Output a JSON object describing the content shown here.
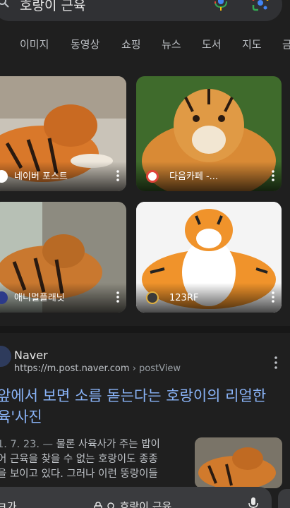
{
  "search": {
    "query": "호랑이 근육"
  },
  "tabs": [
    "이미지",
    "동영상",
    "쇼핑",
    "뉴스",
    "도서",
    "지도",
    "금"
  ],
  "images": [
    {
      "source": "네이버 포스트"
    },
    {
      "source": "다음카페 -..."
    },
    {
      "source": "애니멀플래닛"
    },
    {
      "source": "123RF"
    }
  ],
  "result": {
    "site_name": "Naver",
    "url": "https://m.post.naver.com",
    "breadcrumb": " › postView",
    "title_line1": "앞에서 보면 소름 돋는다는 호랑이의 리얼한",
    "title_line2": "육'사진",
    "snippet_date": "1. 7. 23. — ",
    "snippet_line1": "물론 사육사가 주는 밥이",
    "snippet_line2": "어 근육을 찾을 수 없는 호랑이도 종종",
    "snippet_line3": "을 보이고 있다. 그러나 이런 뚱랑이들"
  },
  "bottom_bar": {
    "left_text": "ㅋ가",
    "query": "호랑이 근육"
  },
  "colors": {
    "background": "#1f1f1f",
    "link": "#8ab4f8",
    "google_blue": "#4285f4",
    "google_red": "#ea4335",
    "google_yellow": "#fbbc05",
    "google_green": "#34a853"
  }
}
